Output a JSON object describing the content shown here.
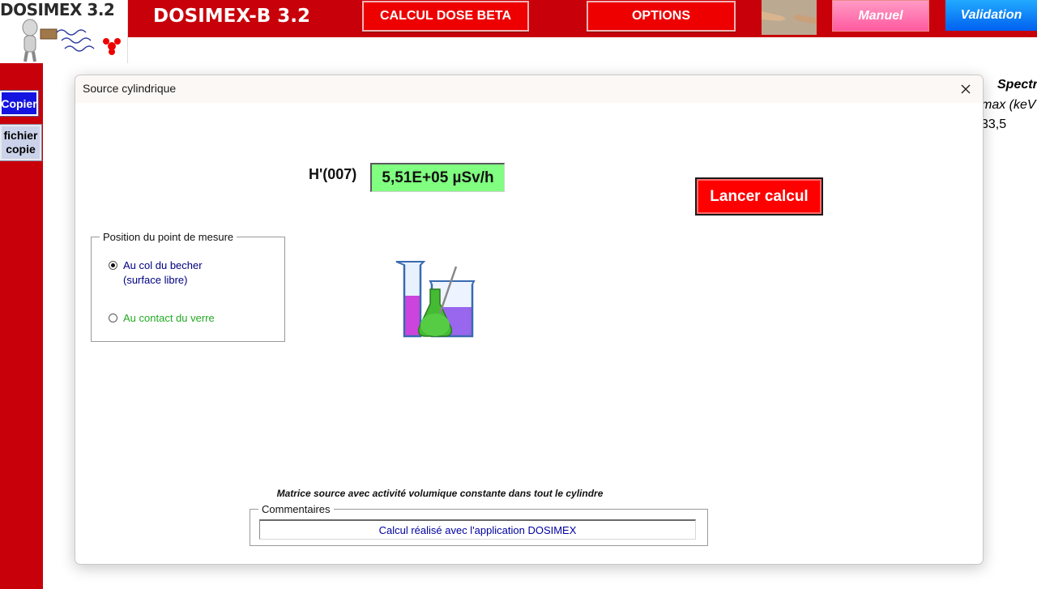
{
  "app": {
    "logo_text": "DOSIMEX 3.2",
    "title": "DOSIMEX-B 3.2"
  },
  "toolbar": {
    "calc_beta_label": "CALCUL DOSE BETA",
    "options_label": "OPTIONS",
    "manuel_label": "Manuel",
    "validation_label": "Validation"
  },
  "sidebar": {
    "copier_label": "Copier",
    "fichier_copie_label": "fichier\ncopie"
  },
  "sheet": {
    "spectr_header": "Spectr",
    "emax_label": "max (keV",
    "emax_value": "33,5"
  },
  "dialog": {
    "title": "Source cylindrique",
    "h_label": "H'(007)",
    "h_value": "5,51E+05 µSv/h",
    "run_button_label": "Lancer calcul",
    "position_group": {
      "legend": "Position du point de mesure",
      "options": [
        {
          "label": "Au col du becher\n(surface libre)",
          "selected": true
        },
        {
          "label": "Au contact du verre",
          "selected": false
        }
      ]
    },
    "caption": "Matrice source avec activité volumique constante dans tout le cylindre",
    "comments": {
      "legend": "Commentaires",
      "value": "Calcul réalisé avec l'application DOSIMEX"
    }
  },
  "colors": {
    "brand_red": "#c8000a",
    "button_red": "#ee0000",
    "result_green": "#80ff80",
    "copier_blue": "#1414e0"
  }
}
